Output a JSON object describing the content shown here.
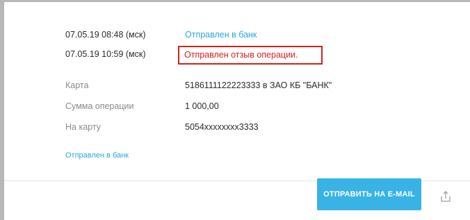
{
  "history": [
    {
      "datetime": "07.05.19 08:48 (мск)",
      "status": "Отправлен в банк"
    },
    {
      "datetime": "07.05.19 10:59 (мск)",
      "status": "Отправлен отзыв операции."
    }
  ],
  "details": [
    {
      "label": "Карта",
      "value": "5186111122223333 в ЗАО КБ \"БАНК\""
    },
    {
      "label": "Сумма операции",
      "value": "1 000,00"
    },
    {
      "label": "На карту",
      "value": "5054xxxxxxxx3333"
    }
  ],
  "footer": {
    "bank_link": "Отправлен в банк",
    "email_button": "ОТПРАВИТЬ НА E-MAIL",
    "share_icon": "share-icon"
  },
  "colors": {
    "accent": "#39b3e6",
    "link": "#29a7d8",
    "highlight": "#d0231b",
    "muted": "#8a8a8a"
  }
}
